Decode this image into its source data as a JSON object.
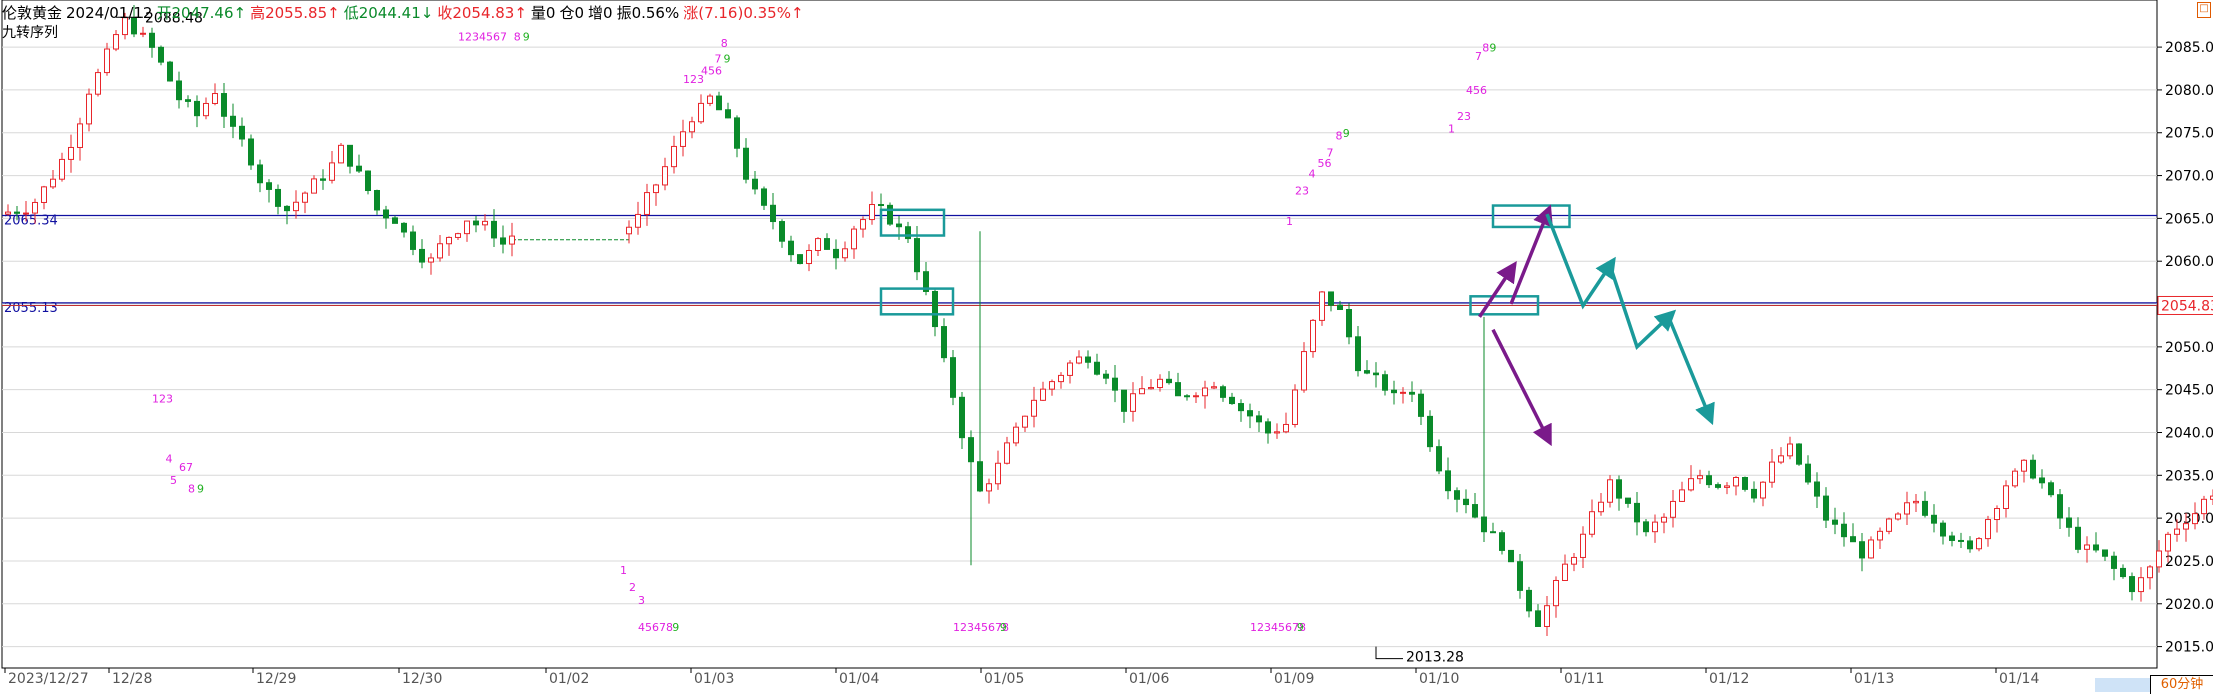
{
  "header": {
    "symbol": "伦敦黄金",
    "date": "2024/01/12",
    "open": "开2047.46↑",
    "high": "高2055.85↑",
    "low": "低2044.41↓",
    "close": "收2054.83↑",
    "vol": "量0",
    "oi": "仓0",
    "add": "增0",
    "amp": "振0.56%",
    "chg": "涨(7.16)0.35%↑",
    "indicator": "九转序列"
  },
  "timeframe": "60分钟",
  "colors": {
    "up": "#e8262b",
    "down": "#0a8a2a",
    "grid": "#d8d8d8",
    "hline": "#1010a0",
    "teal": "#1a9a9a",
    "purple": "#7a1a8a",
    "magenta": "#e020e0",
    "green": "#20b020"
  },
  "chart_data": {
    "type": "candlestick",
    "ylim": [
      2012.5,
      2090.5
    ],
    "y_ticks": [
      "2085.00",
      "2080.00",
      "2075.00",
      "2070.00",
      "2065.00",
      "2060.00",
      "2055.00",
      "2050.00",
      "2045.00",
      "2040.00",
      "2035.00",
      "2030.00",
      "2025.00",
      "2020.00",
      "2015.00"
    ],
    "x_labels": [
      "2023/12/27",
      "12/28",
      "12/29",
      "12/30",
      "01/02",
      "01/03",
      "01/04",
      "01/05",
      "01/06",
      "01/09",
      "01/10",
      "01/11",
      "01/12",
      "01/13",
      "01/14"
    ],
    "current_price": "2054.83",
    "hlines": [
      {
        "value": 2065.34,
        "label": "2065.34"
      },
      {
        "value": 2055.13,
        "label": "2055.13"
      }
    ],
    "extremes": [
      {
        "price": 2088.48,
        "label": "2088.48"
      },
      {
        "price": 2013.28,
        "label": "2013.28"
      }
    ],
    "gap_line_price": 2062.5,
    "segments": [
      {
        "from": 2065.5,
        "path": [
          2066,
          2067,
          2070,
          2074,
          2080,
          2084,
          2088,
          2086,
          2083,
          2079,
          2077,
          2080,
          2075,
          2072,
          2068,
          2066,
          2068,
          2070,
          2073,
          2070,
          2066,
          2065,
          2062,
          2060,
          2063,
          2065,
          2064,
          2062,
          2063
        ]
      },
      {
        "from": 2063.2,
        "path": [
          2065,
          2069,
          2073,
          2077,
          2079,
          2076,
          2070,
          2066,
          2063,
          2060,
          2062,
          2061,
          2064,
          2066,
          2065,
          2063,
          2056,
          2048,
          2040,
          2033,
          2036,
          2040,
          2044,
          2046,
          2048,
          2049,
          2047,
          2043,
          2045,
          2046,
          2044,
          2045,
          2046,
          2044,
          2042,
          2040,
          2041,
          2049,
          2056,
          2054,
          2048,
          2046,
          2044,
          2045,
          2039,
          2034,
          2032,
          2029,
          2027,
          2022,
          2018,
          2022,
          2026,
          2030,
          2034,
          2031,
          2028,
          2030,
          2033,
          2035,
          2034,
          2035,
          2033,
          2036,
          2038,
          2034,
          2030,
          2028,
          2026,
          2028,
          2030,
          2032,
          2030,
          2028,
          2026,
          2030,
          2034,
          2036,
          2034,
          2030,
          2027,
          2026,
          2024,
          2022,
          2024,
          2028,
          2030,
          2032,
          2034,
          2032,
          2030,
          2028,
          2024,
          2018,
          2013.5,
          2020,
          2026,
          2030,
          2034,
          2033,
          2032,
          2034,
          2036,
          2038,
          2040,
          2044,
          2049,
          2054.8
        ]
      }
    ],
    "td_markers": [
      {
        "t": "1234567",
        "c": "#e020e0",
        "price": 2085.8,
        "i": 50
      },
      {
        "t": "8",
        "c": "#e020e0",
        "price": 2085.8,
        "i": 56.2
      },
      {
        "t": "9",
        "c": "#20b020",
        "price": 2085.8,
        "i": 57.2
      },
      {
        "t": "123",
        "c": "#e020e0",
        "price": 2080.8,
        "i": 75
      },
      {
        "t": "456",
        "c": "#e020e0",
        "price": 2081.8,
        "i": 77
      },
      {
        "t": "7",
        "c": "#e020e0",
        "price": 2083.2,
        "i": 78.5
      },
      {
        "t": "9",
        "c": "#20b020",
        "price": 2083.2,
        "i": 79.5
      },
      {
        "t": "8",
        "c": "#e020e0",
        "price": 2085.0,
        "i": 79.2
      },
      {
        "t": "123",
        "c": "#e020e0",
        "price": 2043.5,
        "i": 16
      },
      {
        "t": "4",
        "c": "#e020e0",
        "price": 2036.5,
        "i": 17.5
      },
      {
        "t": "67",
        "c": "#e020e0",
        "price": 2035.5,
        "i": 19
      },
      {
        "t": "5",
        "c": "#e020e0",
        "price": 2034.0,
        "i": 18
      },
      {
        "t": "8",
        "c": "#e020e0",
        "price": 2033.0,
        "i": 20
      },
      {
        "t": "9",
        "c": "#20b020",
        "price": 2033.0,
        "i": 21
      },
      {
        "t": "1",
        "c": "#e020e0",
        "price": 2023.5,
        "i": 68
      },
      {
        "t": "2",
        "c": "#e020e0",
        "price": 2021.5,
        "i": 69
      },
      {
        "t": "3",
        "c": "#e020e0",
        "price": 2020.0,
        "i": 70
      },
      {
        "t": "45678",
        "c": "#e020e0",
        "price": 2016.8,
        "i": 70
      },
      {
        "t": "9",
        "c": "#20b020",
        "price": 2016.8,
        "i": 73.8
      },
      {
        "t": "12345678",
        "c": "#e020e0",
        "price": 2016.8,
        "i": 105
      },
      {
        "t": "9",
        "c": "#20b020",
        "price": 2016.8,
        "i": 110.2
      },
      {
        "t": "12345678",
        "c": "#e020e0",
        "price": 2016.8,
        "i": 138
      },
      {
        "t": "9",
        "c": "#20b020",
        "price": 2016.8,
        "i": 143.2
      },
      {
        "t": "1",
        "c": "#e020e0",
        "price": 2064.2,
        "i": 142
      },
      {
        "t": "23",
        "c": "#e020e0",
        "price": 2067.8,
        "i": 143
      },
      {
        "t": "4",
        "c": "#e020e0",
        "price": 2069.8,
        "i": 144.5
      },
      {
        "t": "56",
        "c": "#e020e0",
        "price": 2071.0,
        "i": 145.5
      },
      {
        "t": "7",
        "c": "#e020e0",
        "price": 2072.2,
        "i": 146.5
      },
      {
        "t": "8",
        "c": "#e020e0",
        "price": 2074.2,
        "i": 147.5
      },
      {
        "t": "9",
        "c": "#20b020",
        "price": 2074.5,
        "i": 148.3
      },
      {
        "t": "1",
        "c": "#e020e0",
        "price": 2075.0,
        "i": 160
      },
      {
        "t": "23",
        "c": "#e020e0",
        "price": 2076.5,
        "i": 161
      },
      {
        "t": "456",
        "c": "#e020e0",
        "price": 2079.5,
        "i": 162
      },
      {
        "t": "7",
        "c": "#e020e0",
        "price": 2083.5,
        "i": 163
      },
      {
        "t": "8",
        "c": "#e020e0",
        "price": 2084.5,
        "i": 163.8
      },
      {
        "t": "9",
        "c": "#20b020",
        "price": 2084.5,
        "i": 164.6
      }
    ],
    "boxes": [
      {
        "i0": 97,
        "i1": 104,
        "p0": 2063.0,
        "p1": 2066.0
      },
      {
        "i0": 97,
        "i1": 105,
        "p0": 2053.8,
        "p1": 2056.8
      },
      {
        "i0": 162.5,
        "i1": 170,
        "p0": 2053.8,
        "p1": 2055.9
      },
      {
        "i0": 165,
        "i1": 173.5,
        "p0": 2064.0,
        "p1": 2066.5
      }
    ],
    "purple_path": [
      [
        163.5,
        2053.5
      ],
      [
        167,
        2059
      ]
    ],
    "purple_path2": [
      [
        167,
        2055
      ],
      [
        171,
        2065.5
      ]
    ],
    "purple_down": [
      [
        165,
        2052
      ],
      [
        171,
        2039.5
      ]
    ],
    "teal_path": [
      [
        171,
        2065.5
      ],
      [
        175,
        2054.8
      ],
      [
        178,
        2059.5
      ]
    ],
    "teal_path2": [
      [
        178,
        2059.5
      ],
      [
        181,
        2050
      ],
      [
        184.5,
        2053.5
      ]
    ],
    "teal_path3": [
      [
        184.5,
        2053.5
      ],
      [
        189,
        2042
      ]
    ]
  }
}
